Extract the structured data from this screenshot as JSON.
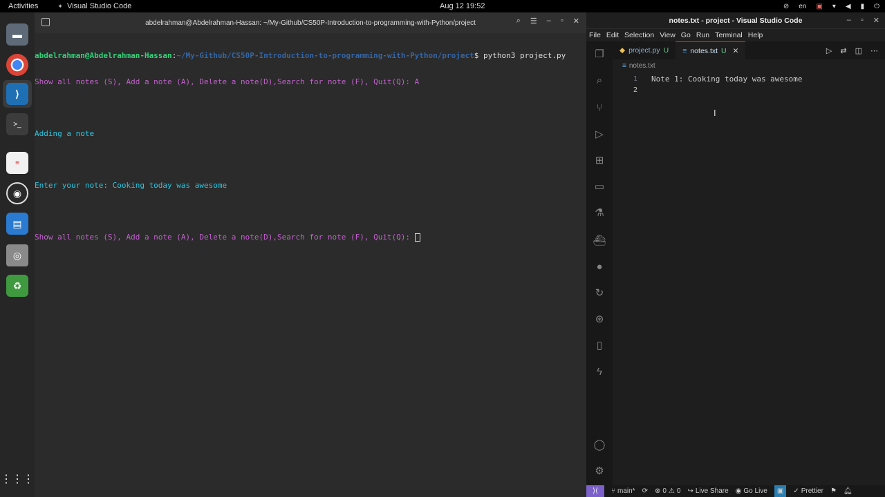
{
  "topbar": {
    "activities": "Activities",
    "app_name": "Visual Studio Code",
    "clock": "Aug 12  19:52",
    "lang": "en"
  },
  "terminal": {
    "title": "abdelrahman@Abdelrahman-Hassan: ~/My-Github/CS50P-Introduction-to-programming-with-Python/project",
    "prompt_user": "abdelrahman@Abdelrahman-Hassan",
    "prompt_sep": ":",
    "prompt_path": "~/My-Github/CS50P-Introduction-to-programming-with-Python/project",
    "prompt_cmd": "$ python3 project.py",
    "menu_line": "Show all notes (S), Add a note (A), Delete a note(D),Search for note (F), Quit(Q): A",
    "adding": "Adding a note",
    "enter_note": "Enter your note: Cooking today was awesome",
    "menu_line2": "Show all notes (S), Add a note (A), Delete a note(D),Search for note (F), Quit(Q): "
  },
  "vscode": {
    "title": "notes.txt - project - Visual Studio Code",
    "menu": [
      "File",
      "Edit",
      "Selection",
      "View",
      "Go",
      "Run",
      "Terminal",
      "Help"
    ],
    "tabs": [
      {
        "label": "project.py",
        "badge": "U"
      },
      {
        "label": "notes.txt",
        "badge": "U"
      }
    ],
    "breadcrumb": "notes.txt",
    "lines": [
      {
        "num": "1",
        "code": "Note 1: Cooking today was awesome"
      },
      {
        "num": "2",
        "code": ""
      }
    ],
    "status": {
      "branch": "main*",
      "errors": "0",
      "warnings": "0",
      "live_share": "Live Share",
      "go_live": "Go Live",
      "prettier": "Prettier"
    }
  }
}
